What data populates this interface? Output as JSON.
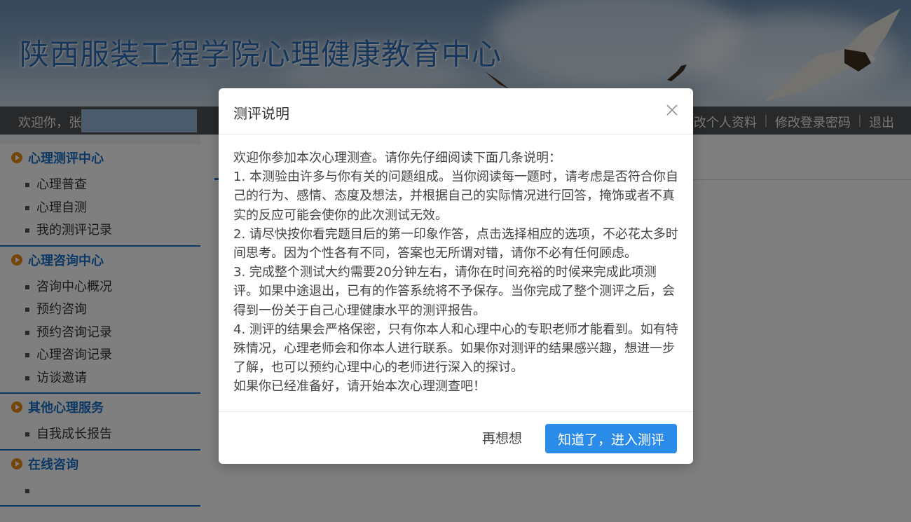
{
  "banner": {
    "title": "陕西服装工程学院心理健康教育中心"
  },
  "topbar": {
    "welcome": "欢迎你，张",
    "links": [
      "修改个人资料",
      "修改登录密码",
      "退出"
    ],
    "separator": "|",
    "links_leading_partial": "多"
  },
  "sidebar": {
    "sections": [
      {
        "title": "心理测评中心",
        "items": [
          "心理普查",
          "心理自测",
          "我的测评记录"
        ]
      },
      {
        "title": "心理咨询中心",
        "items": [
          "咨询中心概况",
          "预约咨询",
          "预约咨询记录",
          "心理咨询记录",
          "访谈邀请"
        ]
      },
      {
        "title": "其他心理服务",
        "items": [
          "自我成长报告"
        ]
      },
      {
        "title": "在线咨询",
        "items": [
          ""
        ]
      }
    ]
  },
  "modal": {
    "title": "测评说明",
    "body": [
      "欢迎你参加本次心理测查。请你先仔细阅读下面几条说明：",
      "1. 本测验由许多与你有关的问题组成。当你阅读每一题时，请考虑是否符合你自己的行为、感情、态度及想法，并根据自己的实际情况进行回答，掩饰或者不真实的反应可能会使你的此次测试无效。",
      "2. 请尽快按你看完题目后的第一印象作答，点击选择相应的选项，不必花太多时间思考。因为个性各有不同，答案也无所谓对错，请你不必有任何顾虑。",
      "3. 完成整个测试大约需要20分钟左右，请你在时间充裕的时候来完成此项测评。如果中途退出，已有的作答系统将不予保存。当你完成了整个测评之后，会得到一份关于自己心理健康水平的测评报告。",
      "4. 测评的结果会严格保密，只有你本人和心理中心的专职老师才能看到。如有特殊情况，心理老师会和你本人进行联系。如果你对测评的结果感兴趣，想进一步了解，也可以预约心理中心的老师进行深入的探讨。",
      "如果你已经准备好，请开始本次心理测查吧！"
    ],
    "cancel_label": "再想想",
    "confirm_label": "知道了，进入测评"
  },
  "colors": {
    "accent": "#2a8ce8",
    "sidebar_title": "#1a73c9",
    "bullet": "#e98a15",
    "topbar": "#4f5256"
  },
  "icons": {
    "close": "close-icon",
    "section_bullet": "play-circle-icon"
  }
}
